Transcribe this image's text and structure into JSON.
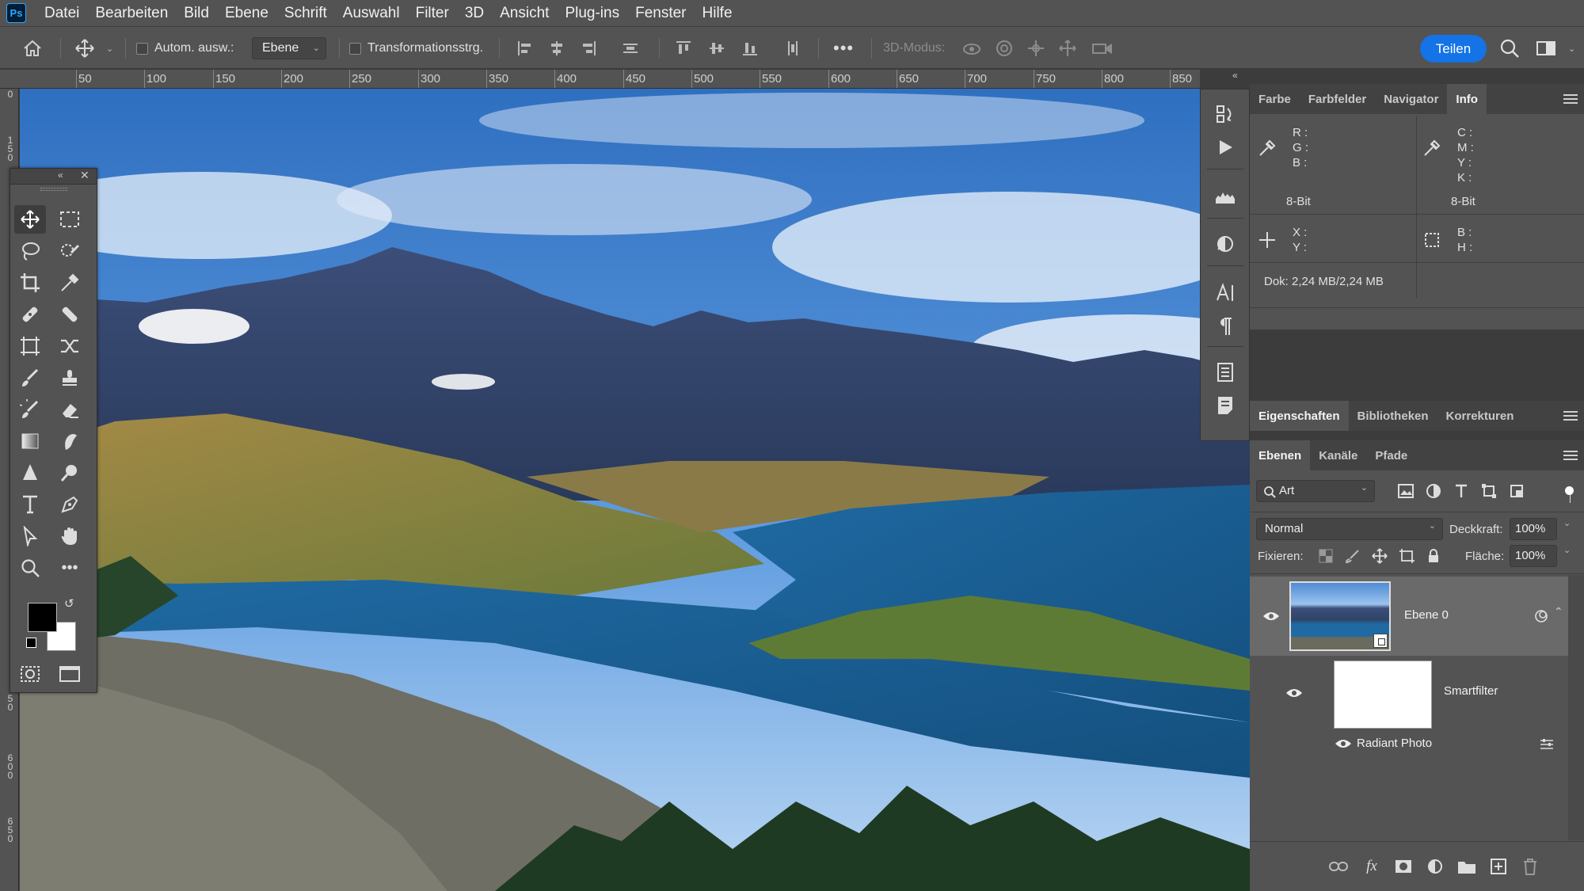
{
  "app": {
    "logo": "Ps"
  },
  "menu": [
    "Datei",
    "Bearbeiten",
    "Bild",
    "Ebene",
    "Schrift",
    "Auswahl",
    "Filter",
    "3D",
    "Ansicht",
    "Plug-ins",
    "Fenster",
    "Hilfe"
  ],
  "options": {
    "auto_select_label": "Autom. ausw.:",
    "auto_select_target": "Ebene",
    "transform_label": "Transformationsstrg.",
    "mode_3d_label": "3D-Modus:",
    "share_label": "Teilen"
  },
  "ruler": {
    "labels": [
      "50",
      "100",
      "150",
      "200",
      "250",
      "300",
      "350",
      "400",
      "450",
      "500",
      "550",
      "600",
      "650",
      "700",
      "750",
      "800",
      "850"
    ]
  },
  "vruler": {
    "labels": [
      "0",
      "1 5 0",
      "5 0",
      "6 0 0",
      "6 5 0"
    ]
  },
  "info_panel": {
    "tabs": [
      "Farbe",
      "Farbfelder",
      "Navigator",
      "Info"
    ],
    "active_tab": "Info",
    "rgb_labels": "R :\nG :\nB :",
    "cmyk_labels": "C :\nM :\nY :\nK :",
    "bit_left": "8-Bit",
    "bit_right": "8-Bit",
    "xy_labels": "X :\nY :",
    "bh_labels": "B :\nH :",
    "doc_size": "Dok: 2,24 MB/2,24 MB"
  },
  "props_panel": {
    "tabs": [
      "Eigenschaften",
      "Bibliotheken",
      "Korrekturen"
    ],
    "active_tab": "Eigenschaften"
  },
  "layers_panel": {
    "tabs": [
      "Ebenen",
      "Kanäle",
      "Pfade"
    ],
    "active_tab": "Ebenen",
    "filter_kind": "Art",
    "blend_mode": "Normal",
    "opacity_label": "Deckkraft:",
    "opacity_value": "100%",
    "lock_label": "Fixieren:",
    "fill_label": "Fläche:",
    "fill_value": "100%",
    "layers": [
      {
        "name": "Ebene 0",
        "visible": true,
        "smart_object": true
      },
      {
        "name": "Smartfilter",
        "visible": true
      },
      {
        "name": "Radiant Photo",
        "visible": true
      }
    ]
  },
  "colors": {
    "accent": "#1473e6",
    "foreground": "#000000",
    "background": "#ffffff"
  }
}
